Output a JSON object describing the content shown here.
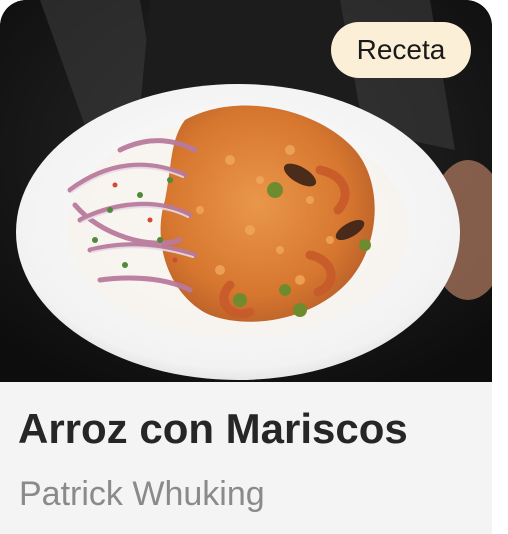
{
  "card": {
    "badge_label": "Receta",
    "title": "Arroz con Mariscos",
    "author": "Patrick Whuking",
    "image_alt": "Plato de arroz con mariscos con salsa criolla"
  },
  "colors": {
    "badge_bg": "#fbefd8",
    "title": "#262626",
    "author": "#8a8a8a",
    "card_bg": "#f4f4f4"
  }
}
